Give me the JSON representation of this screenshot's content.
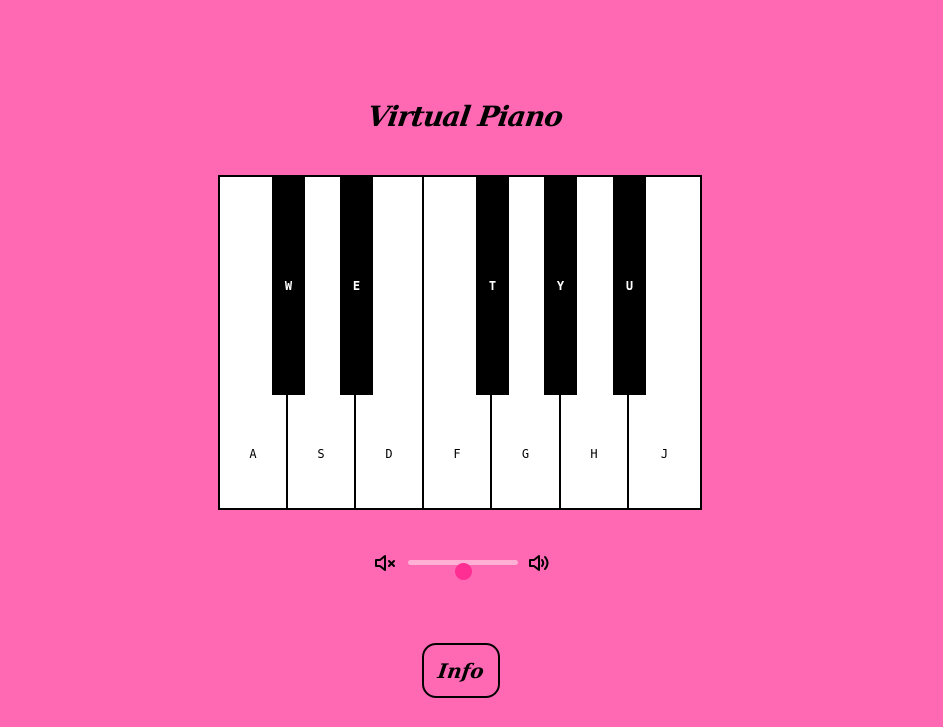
{
  "app": {
    "title": "Virtual Piano"
  },
  "piano": {
    "white_keys": [
      {
        "label": "A"
      },
      {
        "label": "S"
      },
      {
        "label": "D"
      },
      {
        "label": "F"
      },
      {
        "label": "G"
      },
      {
        "label": "H"
      },
      {
        "label": "J"
      }
    ],
    "black_keys": [
      {
        "label": "W"
      },
      {
        "label": "E"
      },
      {
        "label": "T"
      },
      {
        "label": "Y"
      },
      {
        "label": "U"
      }
    ]
  },
  "volume": {
    "min_icon": "volume-mute-icon",
    "max_icon": "volume-up-icon",
    "level": 0.5
  },
  "info_button": {
    "label": "Info"
  },
  "colors": {
    "background": "#ff69b4",
    "slider_thumb": "#ff2e93",
    "slider_track": "#ffb0d4"
  }
}
